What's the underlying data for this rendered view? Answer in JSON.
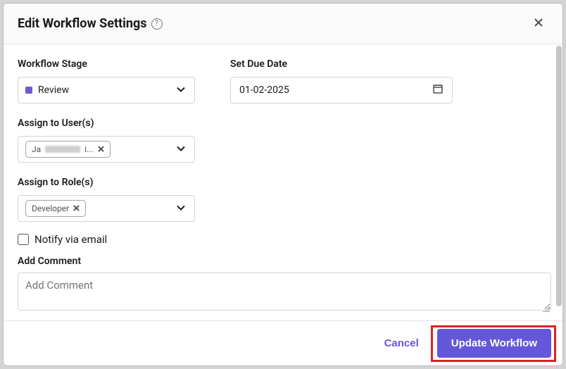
{
  "modal": {
    "title": "Edit Workflow Settings"
  },
  "fields": {
    "workflow_stage": {
      "label": "Workflow Stage",
      "value": "Review"
    },
    "due_date": {
      "label": "Set Due Date",
      "value": "01-02-2025"
    },
    "assign_users": {
      "label": "Assign to User(s)",
      "chip_prefix": "Ja",
      "chip_suffix": "i..."
    },
    "assign_roles": {
      "label": "Assign to Role(s)",
      "chip": "Developer"
    },
    "notify": {
      "label": "Notify via email",
      "checked": false
    },
    "comment": {
      "label": "Add Comment",
      "placeholder": "Add Comment"
    }
  },
  "footer": {
    "cancel": "Cancel",
    "submit": "Update Workflow"
  }
}
